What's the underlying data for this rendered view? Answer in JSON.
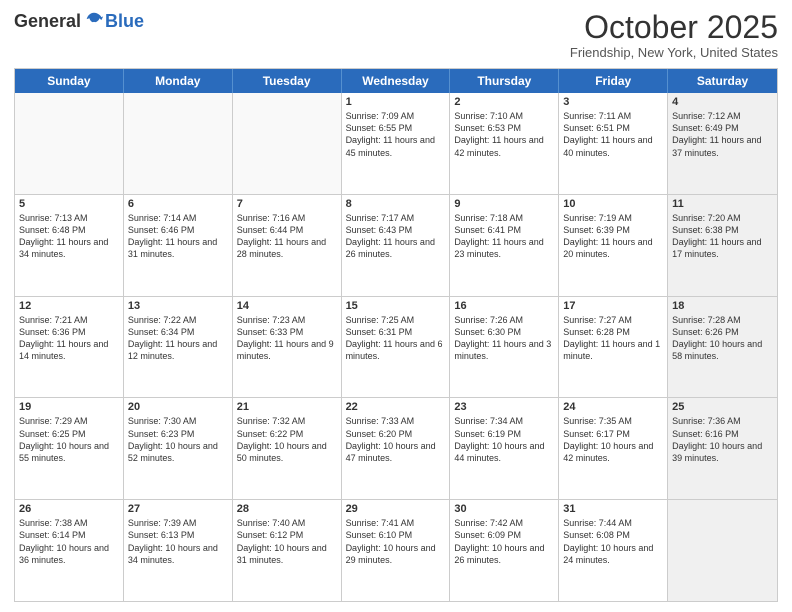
{
  "header": {
    "logo_general": "General",
    "logo_blue": "Blue",
    "title": "October 2025",
    "location": "Friendship, New York, United States"
  },
  "days_of_week": [
    "Sunday",
    "Monday",
    "Tuesday",
    "Wednesday",
    "Thursday",
    "Friday",
    "Saturday"
  ],
  "weeks": [
    [
      {
        "num": "",
        "info": "",
        "empty": true
      },
      {
        "num": "",
        "info": "",
        "empty": true
      },
      {
        "num": "",
        "info": "",
        "empty": true
      },
      {
        "num": "1",
        "info": "Sunrise: 7:09 AM\nSunset: 6:55 PM\nDaylight: 11 hours\nand 45 minutes."
      },
      {
        "num": "2",
        "info": "Sunrise: 7:10 AM\nSunset: 6:53 PM\nDaylight: 11 hours\nand 42 minutes."
      },
      {
        "num": "3",
        "info": "Sunrise: 7:11 AM\nSunset: 6:51 PM\nDaylight: 11 hours\nand 40 minutes."
      },
      {
        "num": "4",
        "info": "Sunrise: 7:12 AM\nSunset: 6:49 PM\nDaylight: 11 hours\nand 37 minutes.",
        "shaded": true
      }
    ],
    [
      {
        "num": "5",
        "info": "Sunrise: 7:13 AM\nSunset: 6:48 PM\nDaylight: 11 hours\nand 34 minutes."
      },
      {
        "num": "6",
        "info": "Sunrise: 7:14 AM\nSunset: 6:46 PM\nDaylight: 11 hours\nand 31 minutes."
      },
      {
        "num": "7",
        "info": "Sunrise: 7:16 AM\nSunset: 6:44 PM\nDaylight: 11 hours\nand 28 minutes."
      },
      {
        "num": "8",
        "info": "Sunrise: 7:17 AM\nSunset: 6:43 PM\nDaylight: 11 hours\nand 26 minutes."
      },
      {
        "num": "9",
        "info": "Sunrise: 7:18 AM\nSunset: 6:41 PM\nDaylight: 11 hours\nand 23 minutes."
      },
      {
        "num": "10",
        "info": "Sunrise: 7:19 AM\nSunset: 6:39 PM\nDaylight: 11 hours\nand 20 minutes."
      },
      {
        "num": "11",
        "info": "Sunrise: 7:20 AM\nSunset: 6:38 PM\nDaylight: 11 hours\nand 17 minutes.",
        "shaded": true
      }
    ],
    [
      {
        "num": "12",
        "info": "Sunrise: 7:21 AM\nSunset: 6:36 PM\nDaylight: 11 hours\nand 14 minutes."
      },
      {
        "num": "13",
        "info": "Sunrise: 7:22 AM\nSunset: 6:34 PM\nDaylight: 11 hours\nand 12 minutes."
      },
      {
        "num": "14",
        "info": "Sunrise: 7:23 AM\nSunset: 6:33 PM\nDaylight: 11 hours\nand 9 minutes."
      },
      {
        "num": "15",
        "info": "Sunrise: 7:25 AM\nSunset: 6:31 PM\nDaylight: 11 hours\nand 6 minutes."
      },
      {
        "num": "16",
        "info": "Sunrise: 7:26 AM\nSunset: 6:30 PM\nDaylight: 11 hours\nand 3 minutes."
      },
      {
        "num": "17",
        "info": "Sunrise: 7:27 AM\nSunset: 6:28 PM\nDaylight: 11 hours\nand 1 minute."
      },
      {
        "num": "18",
        "info": "Sunrise: 7:28 AM\nSunset: 6:26 PM\nDaylight: 10 hours\nand 58 minutes.",
        "shaded": true
      }
    ],
    [
      {
        "num": "19",
        "info": "Sunrise: 7:29 AM\nSunset: 6:25 PM\nDaylight: 10 hours\nand 55 minutes."
      },
      {
        "num": "20",
        "info": "Sunrise: 7:30 AM\nSunset: 6:23 PM\nDaylight: 10 hours\nand 52 minutes."
      },
      {
        "num": "21",
        "info": "Sunrise: 7:32 AM\nSunset: 6:22 PM\nDaylight: 10 hours\nand 50 minutes."
      },
      {
        "num": "22",
        "info": "Sunrise: 7:33 AM\nSunset: 6:20 PM\nDaylight: 10 hours\nand 47 minutes."
      },
      {
        "num": "23",
        "info": "Sunrise: 7:34 AM\nSunset: 6:19 PM\nDaylight: 10 hours\nand 44 minutes."
      },
      {
        "num": "24",
        "info": "Sunrise: 7:35 AM\nSunset: 6:17 PM\nDaylight: 10 hours\nand 42 minutes."
      },
      {
        "num": "25",
        "info": "Sunrise: 7:36 AM\nSunset: 6:16 PM\nDaylight: 10 hours\nand 39 minutes.",
        "shaded": true
      }
    ],
    [
      {
        "num": "26",
        "info": "Sunrise: 7:38 AM\nSunset: 6:14 PM\nDaylight: 10 hours\nand 36 minutes."
      },
      {
        "num": "27",
        "info": "Sunrise: 7:39 AM\nSunset: 6:13 PM\nDaylight: 10 hours\nand 34 minutes."
      },
      {
        "num": "28",
        "info": "Sunrise: 7:40 AM\nSunset: 6:12 PM\nDaylight: 10 hours\nand 31 minutes."
      },
      {
        "num": "29",
        "info": "Sunrise: 7:41 AM\nSunset: 6:10 PM\nDaylight: 10 hours\nand 29 minutes."
      },
      {
        "num": "30",
        "info": "Sunrise: 7:42 AM\nSunset: 6:09 PM\nDaylight: 10 hours\nand 26 minutes."
      },
      {
        "num": "31",
        "info": "Sunrise: 7:44 AM\nSunset: 6:08 PM\nDaylight: 10 hours\nand 24 minutes."
      },
      {
        "num": "",
        "info": "",
        "empty": true,
        "shaded": true
      }
    ]
  ]
}
